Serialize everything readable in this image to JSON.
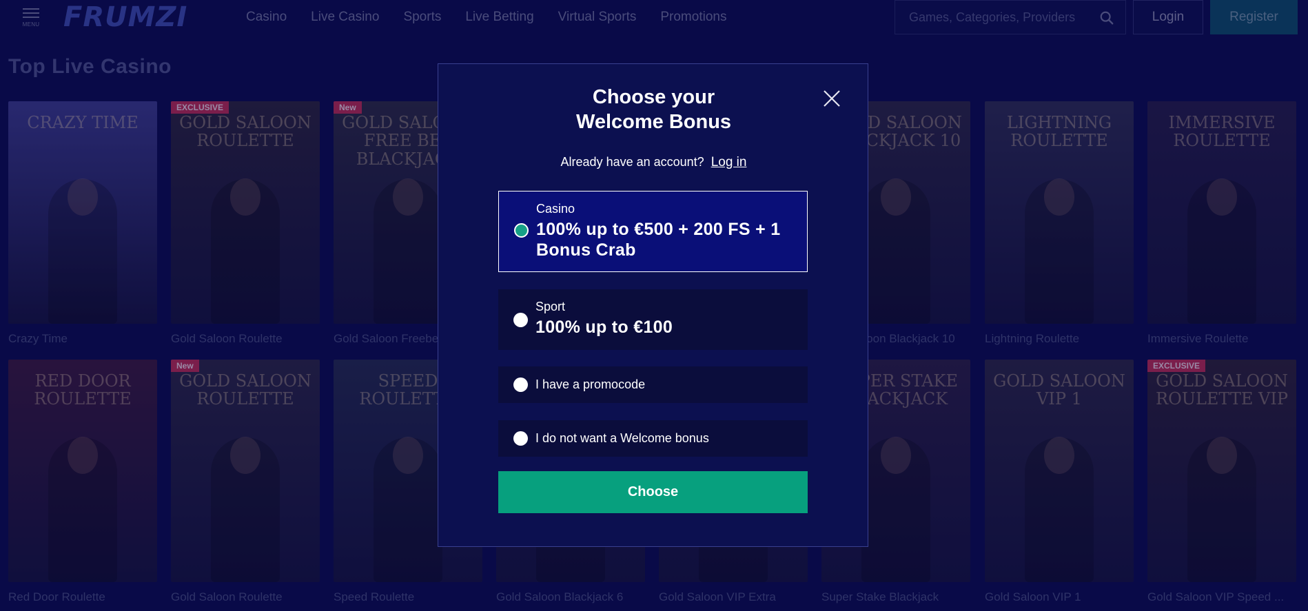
{
  "header": {
    "menu_label": "MENU",
    "logo_text": "FRUMZI",
    "nav": [
      "Casino",
      "Live Casino",
      "Sports",
      "Live Betting",
      "Virtual Sports",
      "Promotions"
    ],
    "search_placeholder": "Games, Categories, Providers",
    "login_label": "Login",
    "register_label": "Register"
  },
  "section": {
    "title": "Top Live Casino"
  },
  "games_row1": [
    {
      "name": "Crazy Time",
      "thumb_text": "CRAZY TIME",
      "color": "#3a3a86",
      "badge": ""
    },
    {
      "name": "Gold Saloon Roulette",
      "thumb_text": "GOLD SALOON ROULETTE",
      "color": "#2a2438",
      "badge": "EXCLUSIVE"
    },
    {
      "name": "Gold Saloon Freebet Blackjack",
      "thumb_text": "GOLD SALOON FREE BET BLACKJACK",
      "color": "#2b2a3e",
      "badge": "New"
    },
    {
      "name": "",
      "thumb_text": "",
      "color": "#1e2046",
      "badge": ""
    },
    {
      "name": "",
      "thumb_text": "",
      "color": "#1e2046",
      "badge": ""
    },
    {
      "name": "Gold Saloon Blackjack 10",
      "thumb_text": "GOLD SALOON BLACKJACK 10",
      "color": "#2a2640",
      "badge": ""
    },
    {
      "name": "Lightning Roulette",
      "thumb_text": "LIGHTNING ROULETTE",
      "color": "#2c2c4e",
      "badge": ""
    },
    {
      "name": "Immersive Roulette",
      "thumb_text": "IMMERSIVE ROULETTE",
      "color": "#241d44",
      "badge": ""
    }
  ],
  "games_row2": [
    {
      "name": "Red Door Roulette",
      "thumb_text": "RED DOOR ROULETTE",
      "color": "#3a1a3a",
      "badge": ""
    },
    {
      "name": "Gold Saloon Roulette",
      "thumb_text": "GOLD SALOON ROULETTE",
      "color": "#2a2640",
      "badge": "New"
    },
    {
      "name": "Speed Roulette",
      "thumb_text": "SPEED ROULETTE",
      "color": "#232a4a",
      "badge": ""
    },
    {
      "name": "Gold Saloon Blackjack 6",
      "thumb_text": "",
      "color": "#24233e",
      "badge": ""
    },
    {
      "name": "Gold Saloon VIP Extra",
      "thumb_text": "",
      "color": "#24233e",
      "badge": ""
    },
    {
      "name": "Super Stake Blackjack",
      "thumb_text": "SUPER STAKE BLACKJACK",
      "color": "#2a1f40",
      "badge": ""
    },
    {
      "name": "Gold Saloon VIP 1",
      "thumb_text": "GOLD SALOON VIP 1",
      "color": "#2a2640",
      "badge": ""
    },
    {
      "name": "Gold Saloon VIP Speed ...",
      "thumb_text": "GOLD SALOON ROULETTE VIP",
      "color": "#2c2234",
      "badge": "EXCLUSIVE"
    }
  ],
  "modal": {
    "title_line1": "Choose your",
    "title_line2": "Welcome Bonus",
    "account_prompt": "Already have an account?",
    "login_link": "Log in",
    "options": [
      {
        "label": "Casino",
        "value_line1": "100% up to €500 + 200 FS + 1",
        "value_line2": "Bonus Crab",
        "selected": true
      },
      {
        "label": "Sport",
        "value_line1": "100% up to €100",
        "value_line2": "",
        "selected": false
      },
      {
        "label": "I have a promocode",
        "value_line1": "",
        "value_line2": "",
        "selected": false
      },
      {
        "label": "I do not want a Welcome bonus",
        "value_line1": "",
        "value_line2": "",
        "selected": false
      }
    ],
    "choose_label": "Choose"
  },
  "colors": {
    "background": "#0a0c4a",
    "modal_bg": "#0c1050",
    "accent_green": "#07a07e",
    "selected_option": "#0a0f78"
  }
}
